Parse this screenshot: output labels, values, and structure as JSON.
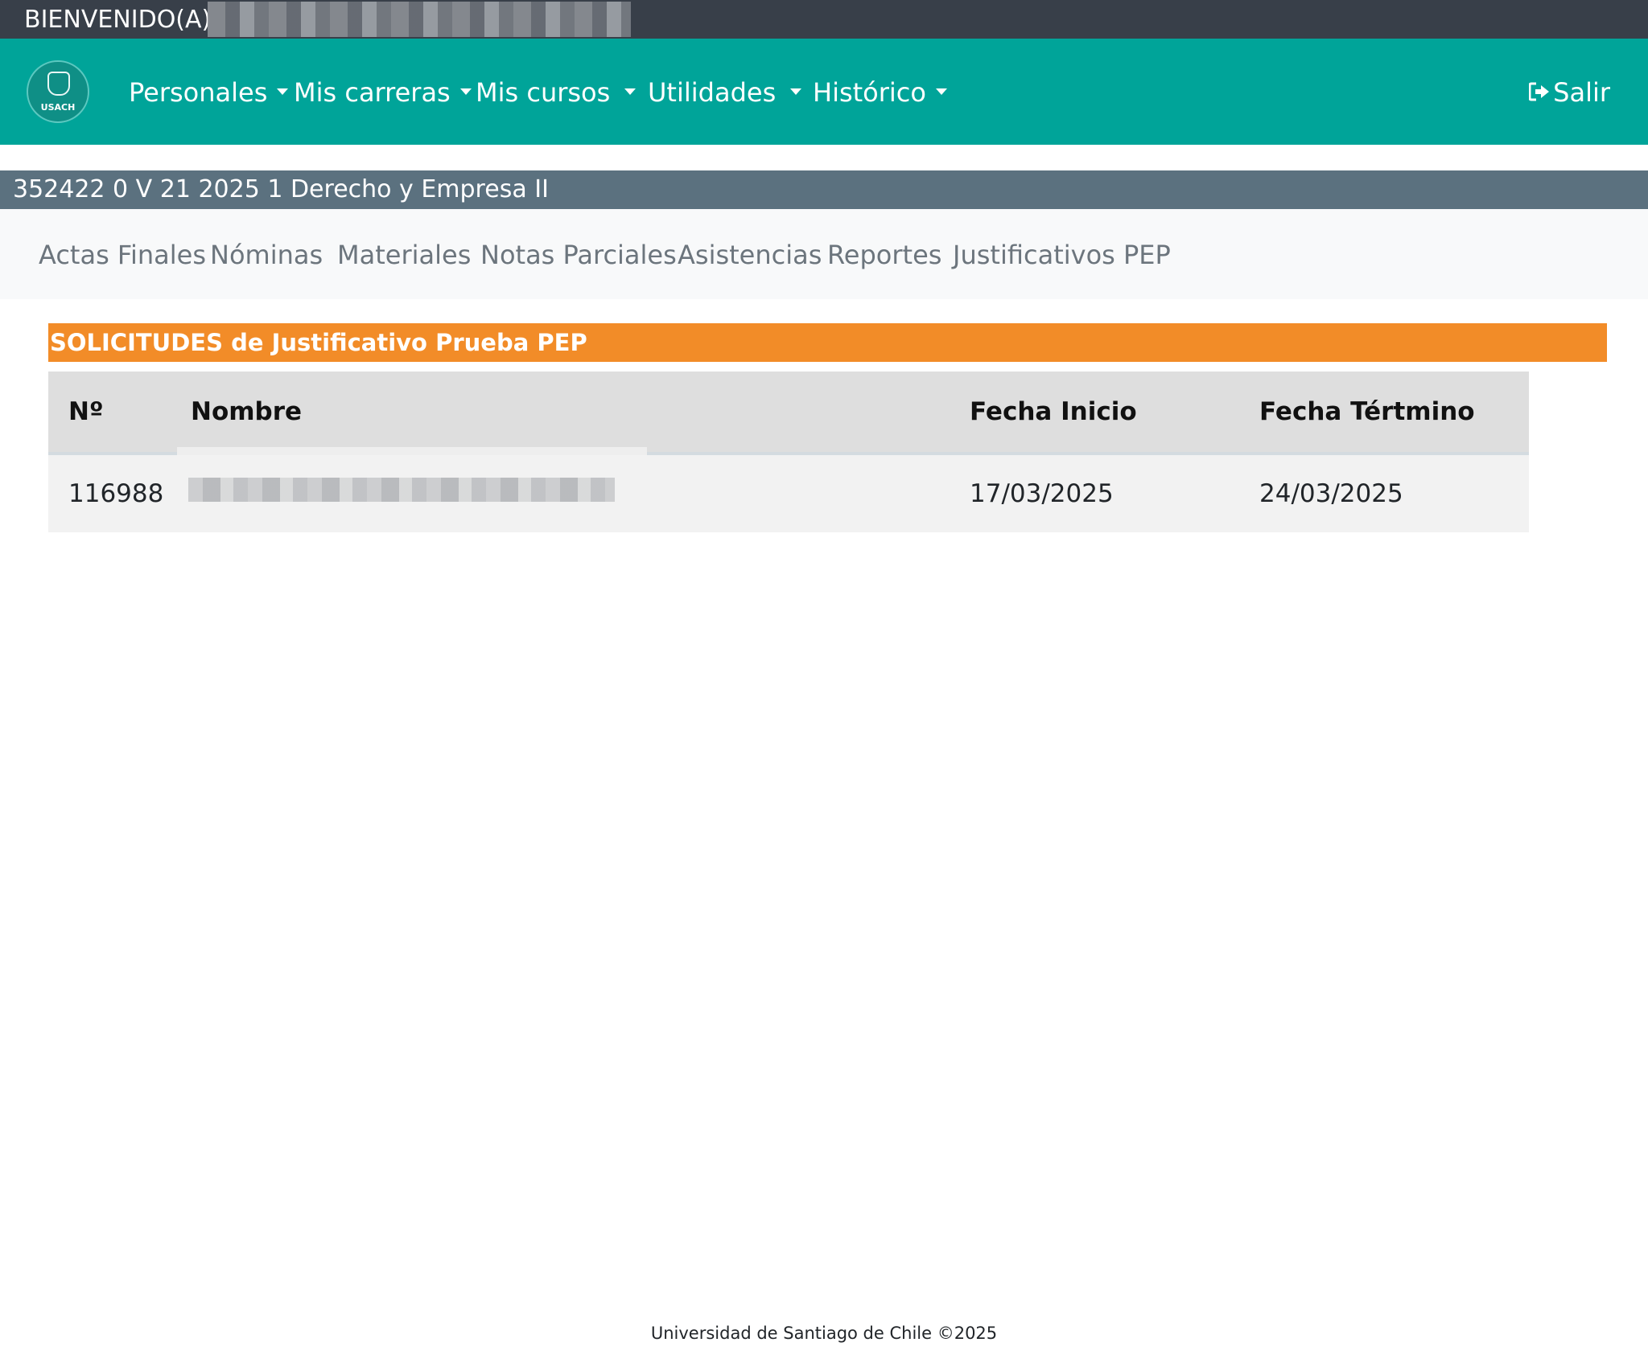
{
  "welcome": {
    "label": "BIENVENIDO(A)"
  },
  "nav": {
    "items": [
      {
        "label": "Personales"
      },
      {
        "label": "Mis carreras"
      },
      {
        "label": "Mis cursos"
      },
      {
        "label": "Utilidades"
      },
      {
        "label": "Histórico"
      }
    ],
    "logo_text": "USACH",
    "exit_label": "Salir",
    "exit_icon": "sign-out-icon"
  },
  "course": {
    "title": "352422 0 V 21 2025 1 Derecho y Empresa II"
  },
  "subnav": {
    "items": [
      {
        "label": "Actas Finales"
      },
      {
        "label": "Nóminas"
      },
      {
        "label": "Materiales"
      },
      {
        "label": "Notas Parciales"
      },
      {
        "label": "Asistencias"
      },
      {
        "label": "Reportes"
      },
      {
        "label": "Justificativos PEP"
      }
    ]
  },
  "section": {
    "title": "SOLICITUDES de Justificativo Prueba PEP"
  },
  "table": {
    "headers": [
      "Nº",
      "Nombre",
      "Fecha Inicio",
      "Fecha Tértmino"
    ],
    "rows": [
      {
        "numero": "116988",
        "nombre": "",
        "fecha_inicio": "17/03/2025",
        "fecha_termino": "24/03/2025"
      }
    ]
  },
  "footer": {
    "text": "Universidad de Santiago de Chile ©2025"
  },
  "colors": {
    "welcome_bar": "#383f49",
    "navbar": "#00a499",
    "course_bar": "#5b717f",
    "section_header": "#f28c28",
    "table_head": "#dedede",
    "table_row": "#f2f2f2"
  }
}
